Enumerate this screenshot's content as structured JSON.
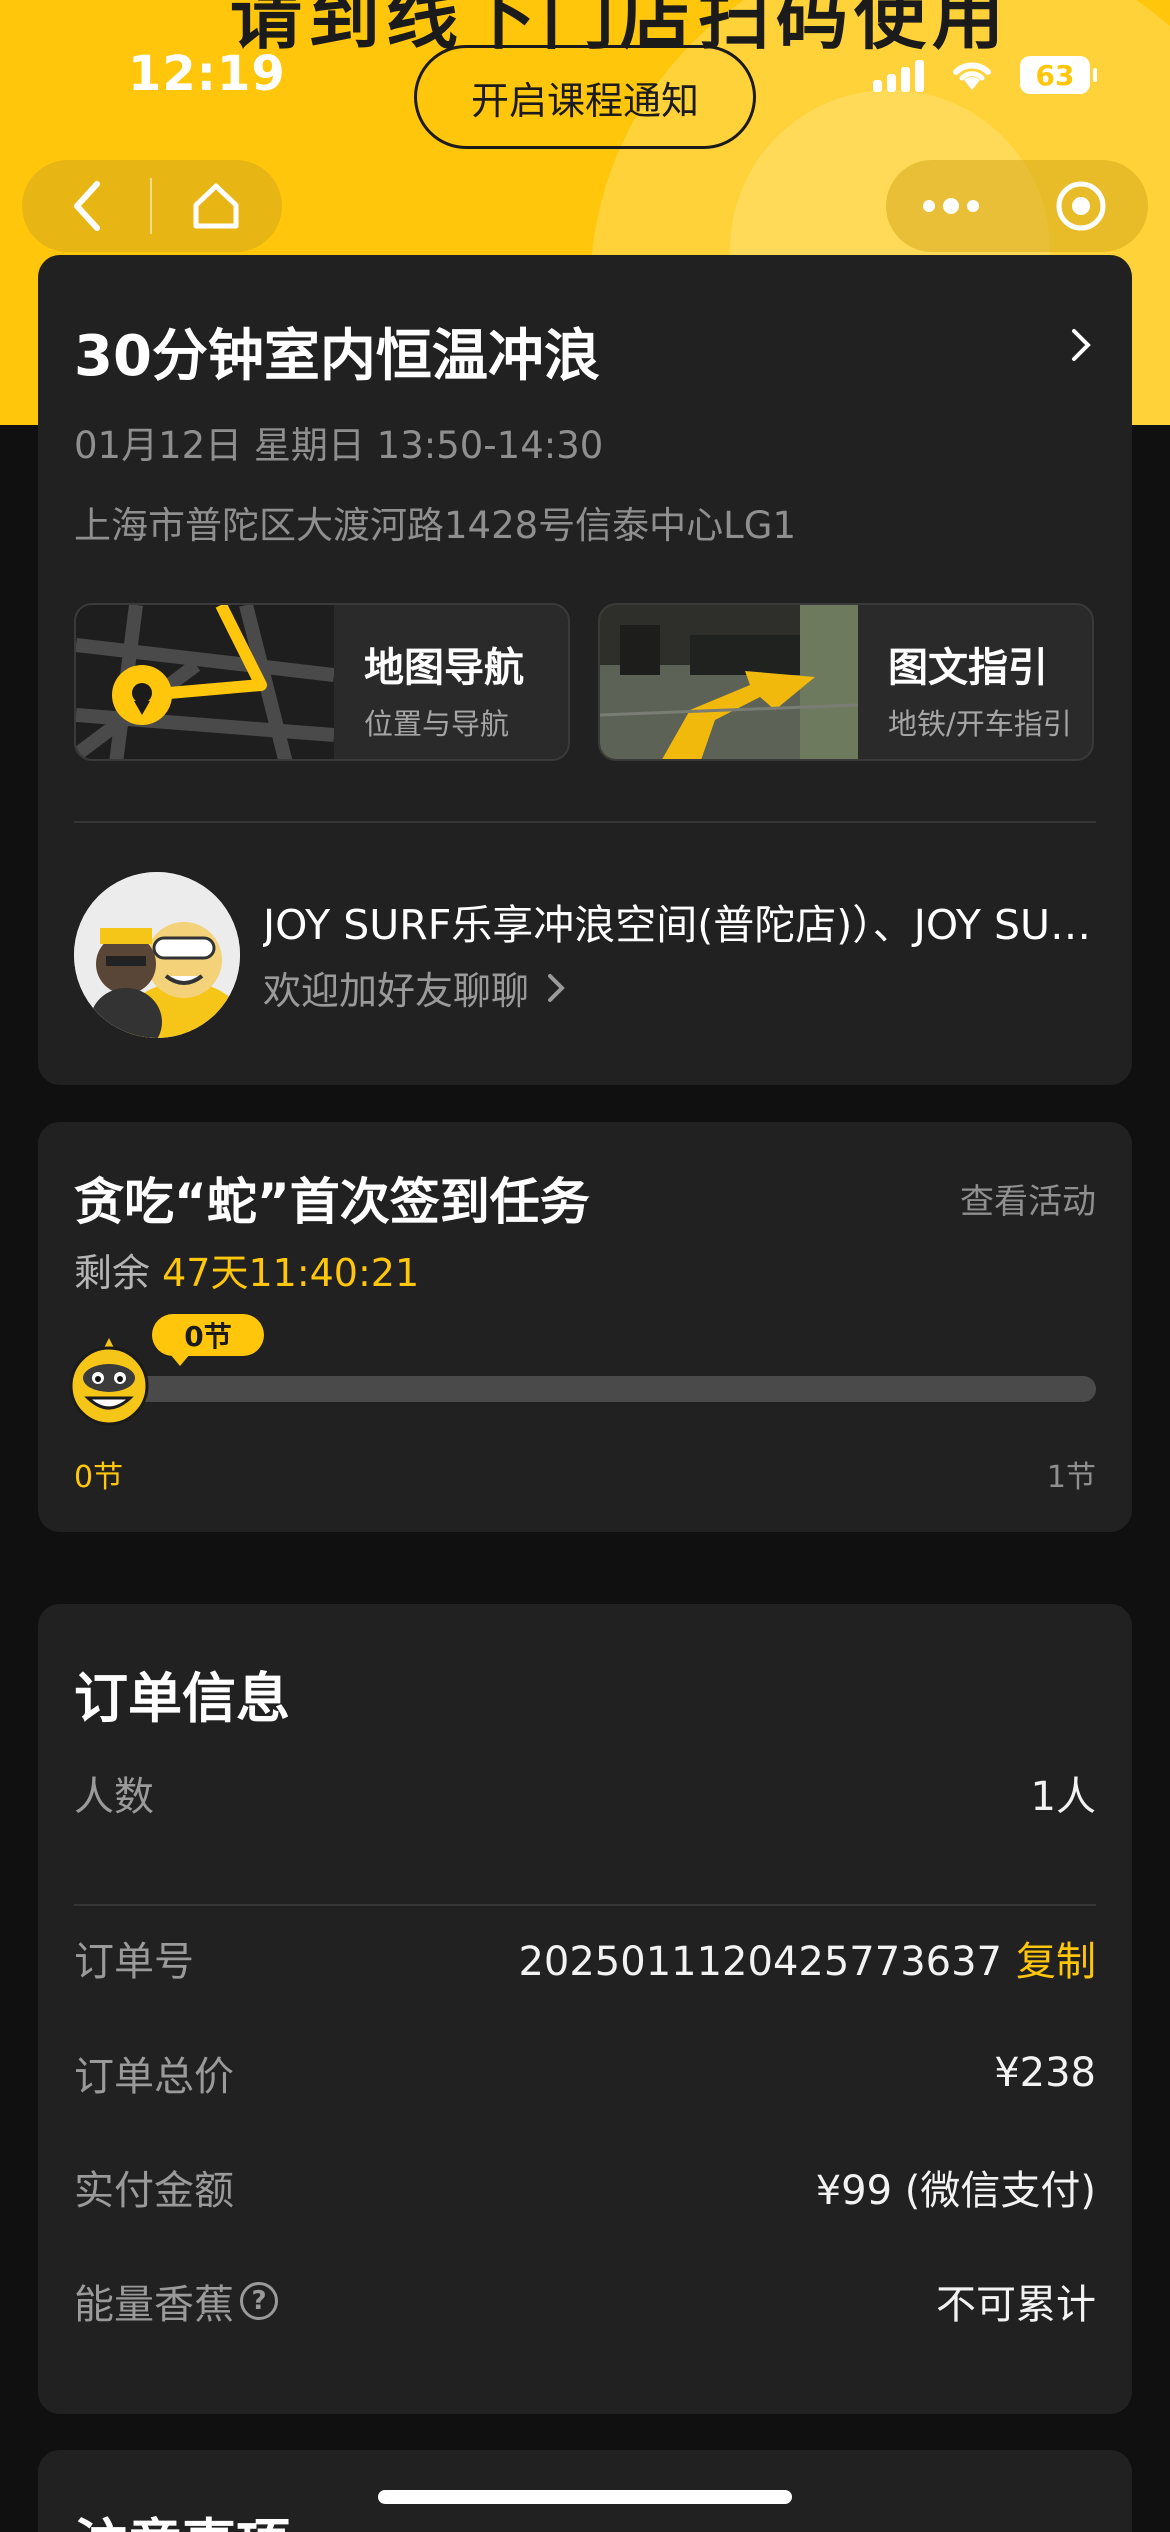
{
  "status_bar": {
    "time": "12:19",
    "battery": "63"
  },
  "header": {
    "clipped_banner_text": "请到线下门店扫码使用",
    "notify_button": "开启课程通知"
  },
  "nav": {
    "back_icon": "chevron-left-icon",
    "home_icon": "home-icon",
    "more_icon": "more-dots-icon",
    "close_icon": "target-close-icon"
  },
  "venue": {
    "title": "30分钟室内恒温冲浪",
    "datetime": "01月12日 星期日 13:50-14:30",
    "address": "上海市普陀区大渡河路1428号信泰中心LG1",
    "guides": [
      {
        "title": "地图导航",
        "subtitle": "位置与导航"
      },
      {
        "title": "图文指引",
        "subtitle": "地铁/开车指引"
      }
    ],
    "store_name": "JOY SURF乐享冲浪空间(普陀店)）、JOY SURF乐享冲浪空间",
    "store_chat": "欢迎加好友聊聊"
  },
  "task": {
    "title": "贪吃“蛇”首次签到任务",
    "link": "查看活动",
    "remaining_label": "剩余",
    "countdown": "47天11:40:21",
    "bubble": "0节",
    "start_label": "0节",
    "end_label": "1节",
    "progress_fraction": 0
  },
  "order": {
    "title": "订单信息",
    "rows": [
      {
        "label": "人数",
        "value": "1人"
      },
      {
        "label": "订单号",
        "value": "2025011120425773637",
        "action": "复制"
      },
      {
        "label": "订单总价",
        "value": "¥238"
      },
      {
        "label": "实付金额",
        "value": "¥99 (微信支付)"
      },
      {
        "label": "能量香蕉",
        "value": "不可累计"
      }
    ]
  },
  "notes": {
    "title": "注意事项"
  },
  "colors": {
    "accent": "#ffc60b",
    "background": "#101010",
    "card": "#212121"
  }
}
